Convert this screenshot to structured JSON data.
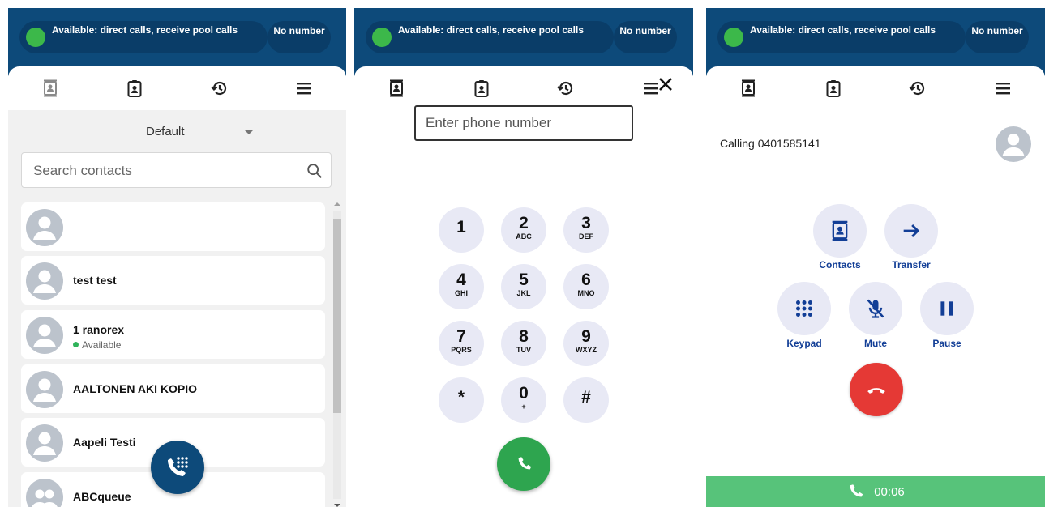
{
  "header": {
    "status_text": "Available: direct calls, receive pool calls",
    "number_text": "No number"
  },
  "nav": {
    "tabs": [
      "contacts-tab",
      "directory-tab",
      "history-tab",
      "menu-tab"
    ]
  },
  "contacts_view": {
    "group_selected": "Default",
    "search_placeholder": "Search contacts",
    "contacts": [
      {
        "name": "",
        "presence": "",
        "avatar": "person"
      },
      {
        "name": "test test",
        "presence": "",
        "avatar": "person"
      },
      {
        "name": "1 ranorex",
        "presence": "Available",
        "avatar": "person"
      },
      {
        "name": "AALTONEN AKI KOPIO",
        "presence": "",
        "avatar": "person"
      },
      {
        "name": "Aapeli Testi",
        "presence": "",
        "avatar": "person"
      },
      {
        "name": "ABCqueue",
        "presence": "",
        "avatar": "group"
      }
    ]
  },
  "dialer_view": {
    "input_placeholder": "Enter phone number",
    "keys": [
      {
        "digit": "1",
        "letters": ""
      },
      {
        "digit": "2",
        "letters": "ABC"
      },
      {
        "digit": "3",
        "letters": "DEF"
      },
      {
        "digit": "4",
        "letters": "GHI"
      },
      {
        "digit": "5",
        "letters": "JKL"
      },
      {
        "digit": "6",
        "letters": "MNO"
      },
      {
        "digit": "7",
        "letters": "PQRS"
      },
      {
        "digit": "8",
        "letters": "TUV"
      },
      {
        "digit": "9",
        "letters": "WXYZ"
      },
      {
        "digit": "*",
        "letters": ""
      },
      {
        "digit": "0",
        "letters": "+"
      },
      {
        "digit": "#",
        "letters": ""
      }
    ]
  },
  "call_view": {
    "calling_text": "Calling 0401585141",
    "actions": {
      "contacts": "Contacts",
      "transfer": "Transfer",
      "keypad": "Keypad",
      "mute": "Mute",
      "pause": "Pause"
    },
    "timer": "00:06"
  },
  "colors": {
    "header": "#0d4a7a",
    "status_green": "#3cb84a",
    "accent_blue": "#123e96",
    "call_green": "#2ea54f",
    "hangup_red": "#e53935",
    "timer_green": "#57c37a"
  }
}
